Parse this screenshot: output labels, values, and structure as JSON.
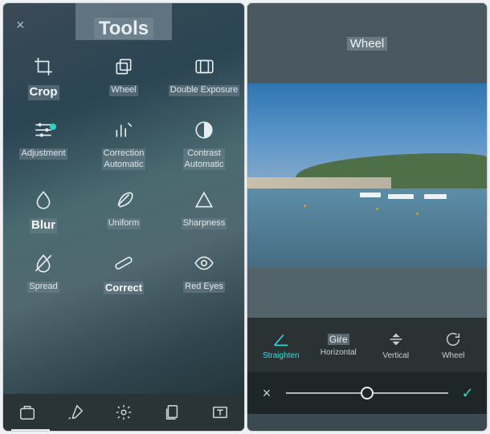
{
  "left": {
    "title": "Tools",
    "close_label": "×",
    "tools": [
      {
        "id": "crop",
        "label": "Crop",
        "icon": "crop-icon"
      },
      {
        "id": "wheel",
        "label": "Wheel",
        "icon": "rotate-stack-icon"
      },
      {
        "id": "double",
        "label": "Double Exposure",
        "icon": "double-exposure-icon"
      },
      {
        "id": "adjustment",
        "label": "Adjustment",
        "icon": "sliders-icon",
        "badge": true
      },
      {
        "id": "corr-auto",
        "label": "Correction\nAutomatic",
        "icon": "bar-wand-icon"
      },
      {
        "id": "contr-auto",
        "label": "Contrast\nAutomatic",
        "icon": "half-circle-icon"
      },
      {
        "id": "blur",
        "label": "Blur",
        "icon": "drop-icon"
      },
      {
        "id": "uniform",
        "label": "Uniform",
        "icon": "feather-icon"
      },
      {
        "id": "sharpness",
        "label": "Sharpness",
        "icon": "triangle-icon"
      },
      {
        "id": "spread",
        "label": "Spread",
        "icon": "drop-slash-icon"
      },
      {
        "id": "correct",
        "label": "Correct",
        "icon": "bandage-icon"
      },
      {
        "id": "redeyes",
        "label": "Red Eyes",
        "icon": "eye-icon"
      }
    ],
    "bottom_tabs": [
      {
        "id": "presets",
        "icon": "presets-icon"
      },
      {
        "id": "brush",
        "icon": "brush-icon"
      },
      {
        "id": "settings",
        "icon": "gear-icon"
      },
      {
        "id": "copy",
        "icon": "copy-icon"
      },
      {
        "id": "text",
        "icon": "text-box-icon"
      }
    ],
    "active_tab": "presets"
  },
  "right": {
    "title": "Wheel",
    "ops": [
      {
        "id": "straighten",
        "label": "Straighten",
        "icon": "angle-icon",
        "active": true
      },
      {
        "id": "horizontal",
        "label": "Horizontal",
        "sublabel": "Giṙe",
        "icon": "flip-h-icon"
      },
      {
        "id": "vertical",
        "label": "Vertical",
        "icon": "flip-v-icon"
      },
      {
        "id": "wheel",
        "label": "Wheel",
        "icon": "rotate-cw-icon"
      }
    ],
    "slider": {
      "value": 0,
      "min": -100,
      "max": 100
    },
    "cancel_label": "×",
    "apply_label": "✓"
  }
}
